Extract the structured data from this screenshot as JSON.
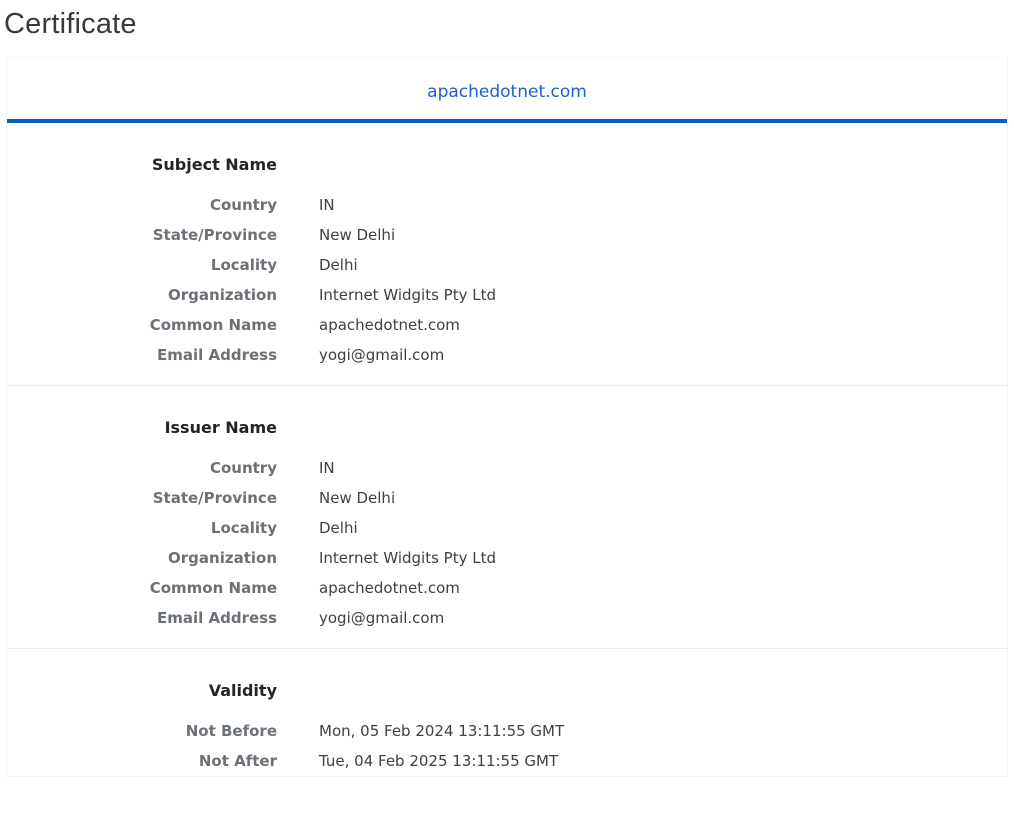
{
  "page": {
    "title": "Certificate"
  },
  "tabs": [
    {
      "label": "apachedotnet.com",
      "active": true
    }
  ],
  "sections": [
    {
      "id": "subject-name",
      "title": "Subject Name",
      "rows": [
        {
          "label": "Country",
          "value": "IN"
        },
        {
          "label": "State/Province",
          "value": "New Delhi"
        },
        {
          "label": "Locality",
          "value": "Delhi"
        },
        {
          "label": "Organization",
          "value": "Internet Widgits Pty Ltd"
        },
        {
          "label": "Common Name",
          "value": "apachedotnet.com"
        },
        {
          "label": "Email Address",
          "value": "yogi@gmail.com"
        }
      ]
    },
    {
      "id": "issuer-name",
      "title": "Issuer Name",
      "rows": [
        {
          "label": "Country",
          "value": "IN"
        },
        {
          "label": "State/Province",
          "value": "New Delhi"
        },
        {
          "label": "Locality",
          "value": "Delhi"
        },
        {
          "label": "Organization",
          "value": "Internet Widgits Pty Ltd"
        },
        {
          "label": "Common Name",
          "value": "apachedotnet.com"
        },
        {
          "label": "Email Address",
          "value": "yogi@gmail.com"
        }
      ]
    },
    {
      "id": "validity",
      "title": "Validity",
      "rows": [
        {
          "label": "Not Before",
          "value": "Mon, 05 Feb 2024 13:11:55 GMT"
        },
        {
          "label": "Not After",
          "value": "Tue, 04 Feb 2025 13:11:55 GMT"
        }
      ]
    }
  ],
  "colors": {
    "tab_link": "#1d5fcb",
    "tab_underline": "#0c5cd0",
    "section_title": "#212529",
    "row_label": "#6b7177",
    "row_value": "#3c4146",
    "divider": "#e9ecef"
  }
}
